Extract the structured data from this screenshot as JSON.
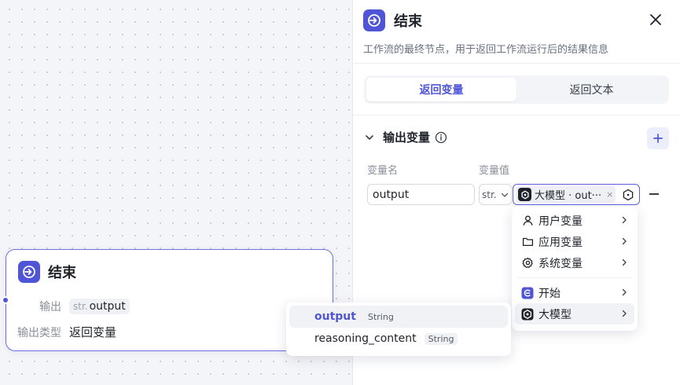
{
  "canvas": {
    "node": {
      "title": "结束",
      "output_label": "输出",
      "output_type_prefix": "str.",
      "output_name": "output",
      "output_kind_label": "输出类型",
      "output_kind_value": "返回变量"
    },
    "output_popup": {
      "items": [
        {
          "name": "output",
          "type": "String",
          "active": true
        },
        {
          "name": "reasoning_content",
          "type": "String",
          "active": false
        }
      ]
    }
  },
  "panel": {
    "title": "结束",
    "description": "工作流的最终节点，用于返回工作流运行后的结果信息",
    "tabs": [
      {
        "label": "返回变量",
        "active": true
      },
      {
        "label": "返回文本",
        "active": false
      }
    ],
    "section_title": "输出变量",
    "col_name": "变量名",
    "col_value": "变量值",
    "row": {
      "name_value": "output",
      "type_value": "str.",
      "value_chip": "大模型 · out···",
      "clear_glyph": "×"
    },
    "var_menu": {
      "groups": [
        [
          {
            "label": "用户变量",
            "icon": "user-icon"
          },
          {
            "label": "应用变量",
            "icon": "folder-icon"
          },
          {
            "label": "系统变量",
            "icon": "gear-icon"
          }
        ],
        [
          {
            "label": "开始",
            "icon": "start-node-icon"
          },
          {
            "label": "大模型",
            "icon": "llm-node-icon"
          }
        ]
      ]
    }
  },
  "colors": {
    "accent": "#4f55d6",
    "accent_border": "#5a5fe0",
    "text": "#1f2329",
    "muted": "#8a8f99"
  }
}
